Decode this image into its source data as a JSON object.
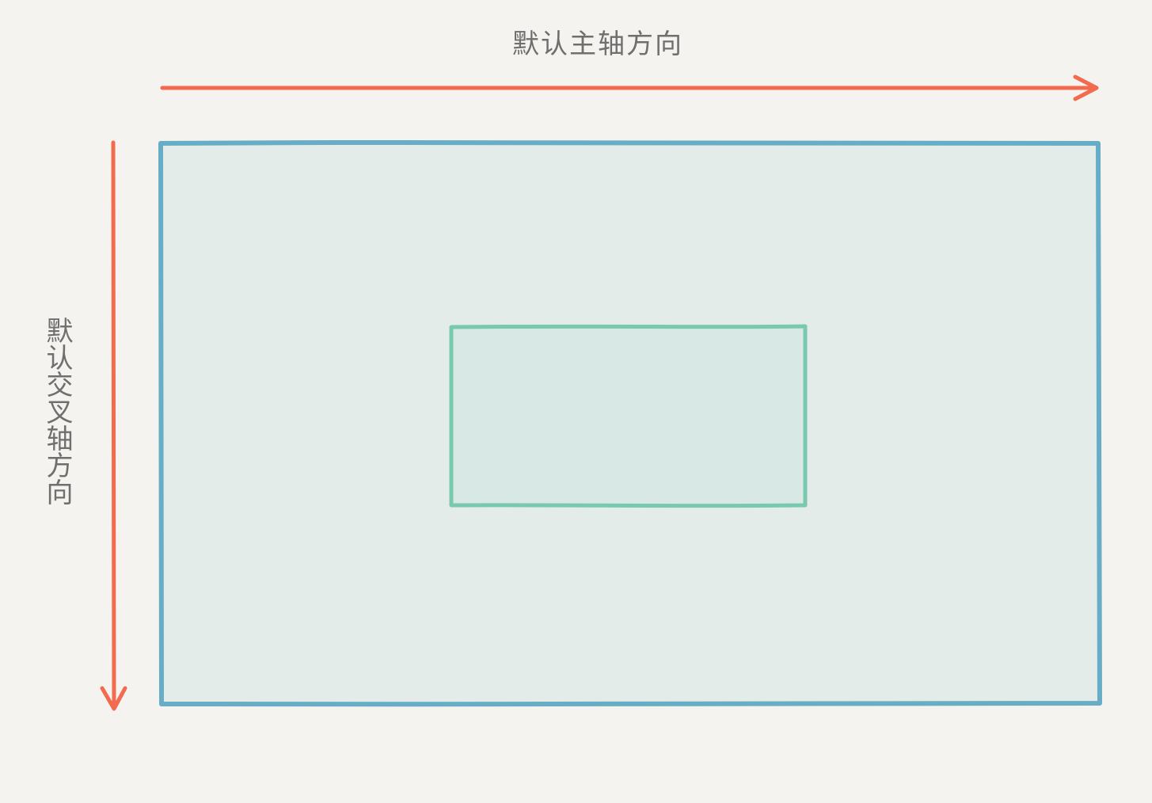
{
  "labels": {
    "main_axis": "默认主轴方向",
    "cross_axis": "默认交叉轴方向"
  },
  "colors": {
    "background": "#f5f3ef",
    "axis_arrow": "#f26b4f",
    "container_border": "#67adc5",
    "container_fill": "#e4ecea",
    "item_border": "#79c9ae",
    "item_fill": "#d7e8e5",
    "label_text": "#6f6f6f"
  }
}
